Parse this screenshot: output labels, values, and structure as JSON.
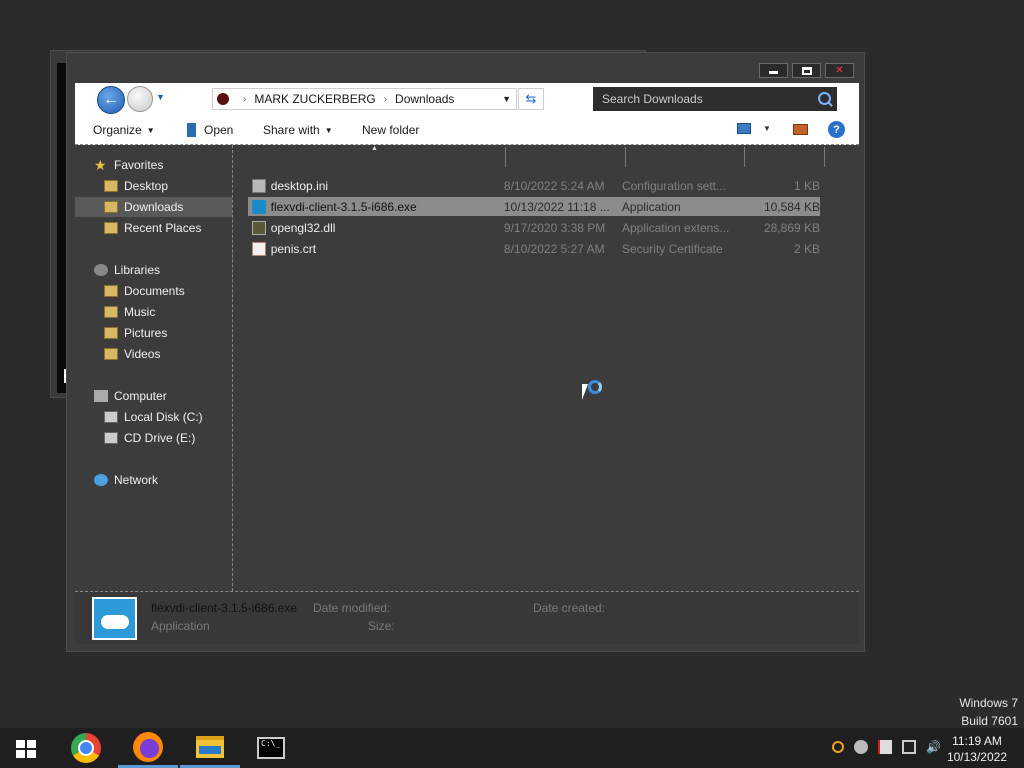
{
  "background_window": {},
  "explorer": {
    "controls": {
      "minimize": "",
      "maximize": "",
      "close": "✕"
    },
    "breadcrumb": {
      "root": "MARK ZUCKERBERG",
      "current": "Downloads"
    },
    "search": {
      "placeholder": "Search Downloads"
    },
    "toolbar": {
      "organize": "Organize",
      "open": "Open",
      "share_with": "Share with",
      "new_folder": "New folder",
      "help": "?"
    },
    "sidebar": {
      "favorites": "Favorites",
      "desktop": "Desktop",
      "downloads": "Downloads",
      "recent_places": "Recent Places",
      "libraries": "Libraries",
      "documents": "Documents",
      "music": "Music",
      "pictures": "Pictures",
      "videos": "Videos",
      "computer": "Computer",
      "local_disk": "Local Disk (C:)",
      "cd_drive": "CD Drive (E:)",
      "network": "Network"
    },
    "files": [
      {
        "name": "desktop.ini",
        "date": "8/10/2022 5:24 AM",
        "type": "Configuration sett...",
        "size": "1 KB",
        "icon": "settings-file-icon"
      },
      {
        "name": "flexvdi-client-3.1.5-i686.exe",
        "date": "10/13/2022 11:18 ...",
        "type": "Application",
        "size": "10,584 KB",
        "icon": "cloud-app-icon"
      },
      {
        "name": "opengl32.dll",
        "date": "9/17/2020 3:38 PM",
        "type": "Application extens...",
        "size": "28,869 KB",
        "icon": "dll-file-icon"
      },
      {
        "name": "penis.crt",
        "date": "8/10/2022 5:27 AM",
        "type": "Security Certificate",
        "size": "2 KB",
        "icon": "certificate-icon"
      }
    ],
    "details": {
      "name": "flexvdi-client-3.1.5-i686.exe",
      "type": "Application",
      "date_modified_label": "Date modified:",
      "date_created_label": "Date created:",
      "size_label": "Size:"
    }
  },
  "watermark": {
    "line1": "Windows 7",
    "line2": "Build 7601"
  },
  "taskbar": {
    "cmd_text": "C:\\_",
    "clock_time": "11:19 AM",
    "clock_date": "10/13/2022"
  },
  "colors": {
    "selection": "#8c8c8c",
    "accent": "#2a6fc9",
    "taskbar": "#1f1f1f"
  }
}
